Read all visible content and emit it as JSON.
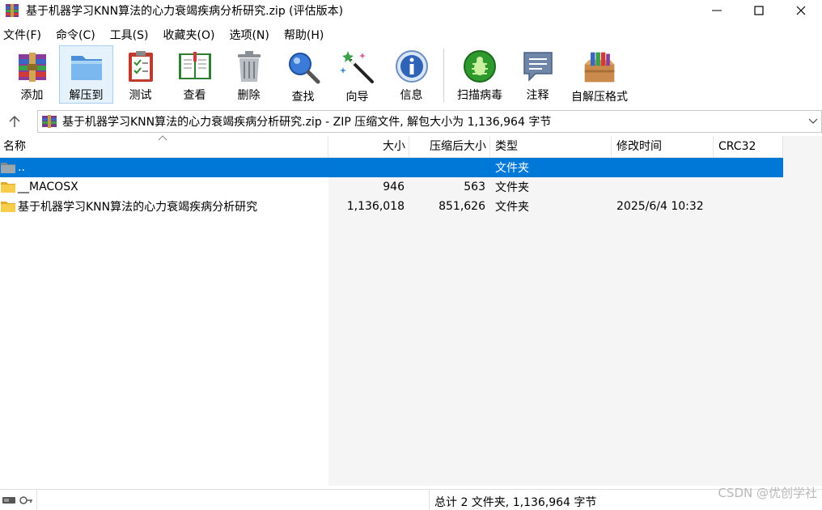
{
  "window": {
    "title": "基于机器学习KNN算法的心力衰竭疾病分析研究.zip (评估版本)"
  },
  "menu": [
    {
      "label": "文件(F)"
    },
    {
      "label": "命令(C)"
    },
    {
      "label": "工具(S)"
    },
    {
      "label": "收藏夹(O)"
    },
    {
      "label": "选项(N)"
    },
    {
      "label": "帮助(H)"
    }
  ],
  "toolbar": {
    "add": "添加",
    "extract_to": "解压到",
    "test": "测试",
    "view": "查看",
    "delete": "删除",
    "find": "查找",
    "wizard": "向导",
    "info": "信息",
    "virus_scan": "扫描病毒",
    "comment": "注释",
    "sfx": "自解压格式"
  },
  "address": {
    "text": "基于机器学习KNN算法的心力衰竭疾病分析研究.zip - ZIP 压缩文件, 解包大小为 1,136,964 字节"
  },
  "columns": {
    "name": "名称",
    "size": "大小",
    "packed": "压缩后大小",
    "type": "类型",
    "modified": "修改时间",
    "crc": "CRC32"
  },
  "rows": [
    {
      "name": "..",
      "size": "",
      "packed": "",
      "type": "文件夹",
      "modified": "",
      "crc": ""
    },
    {
      "name": "__MACOSX",
      "size": "946",
      "packed": "563",
      "type": "文件夹",
      "modified": "",
      "crc": ""
    },
    {
      "name": "基于机器学习KNN算法的心力衰竭疾病分析研究",
      "size": "1,136,018",
      "packed": "851,626",
      "type": "文件夹",
      "modified": "2025/6/4 10:32",
      "crc": ""
    }
  ],
  "status": {
    "summary": "总计 2 文件夹, 1,136,964 字节"
  },
  "watermark": "CSDN @优创学社",
  "colors": {
    "selection": "#0078d7",
    "toolbar_active": "#e5f1fb"
  }
}
